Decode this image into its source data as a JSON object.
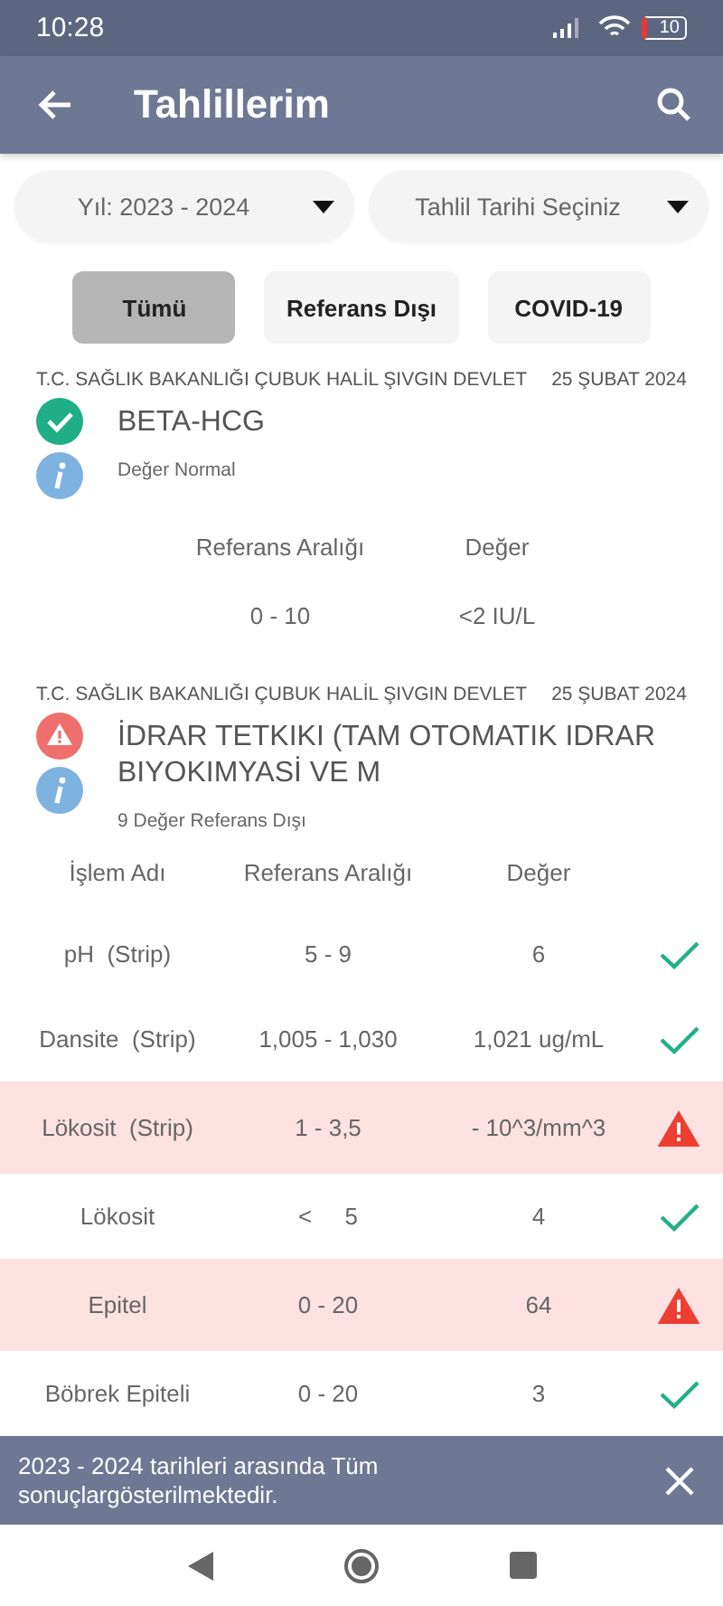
{
  "status_bar": {
    "time": "10:28",
    "battery": "10"
  },
  "app_bar": {
    "title": "Tahlillerim"
  },
  "filters": [
    {
      "value": "Yıl: 2023 - 2024"
    },
    {
      "value": "Tahlil Tarihi Seçiniz"
    }
  ],
  "chips": [
    {
      "label": "Tümü",
      "selected": true
    },
    {
      "label": "Referans Dışı",
      "selected": false
    },
    {
      "label": "COVID-19",
      "selected": false
    }
  ],
  "results": [
    {
      "hospital": "T.C. SAĞLIK BAKANLIĞI ÇUBUK HALİL ŞIVGIN DEVLET",
      "date": "25 ŞUBAT 2024",
      "name": "BETA-HCG",
      "out_of_range": false,
      "summary": "Değer Normal",
      "columns": [
        "Referans Aralığı",
        "Değer"
      ],
      "rows": [
        {
          "cells": [
            "0 - 10",
            "<2 IU/L"
          ]
        }
      ]
    },
    {
      "hospital": "T.C. SAĞLIK BAKANLIĞI ÇUBUK HALİL ŞIVGIN DEVLET",
      "date": "25 ŞUBAT 2024",
      "name": "İDRAR TETKIKI (TAM OTOMATIK IDRAR BIYOKIMYASİ VE M",
      "out_of_range": true,
      "summary": "9 Değer Referans Dışı",
      "columns": [
        "İşlem Adı",
        "Referans Aralığı",
        "Değer"
      ],
      "rows": [
        {
          "cells": [
            "pH  (Strip)",
            "5 - 9",
            "6"
          ],
          "out_of_range": false
        },
        {
          "cells": [
            "Dansite  (Strip)",
            "1,005 - 1,030",
            "1,021 ug/mL"
          ],
          "out_of_range": false
        },
        {
          "cells": [
            "Lökosit  (Strip)",
            "1 - 3,5",
            "- 10^3/mm^3"
          ],
          "out_of_range": true
        },
        {
          "cells": [
            "Lökosit",
            "<     5",
            "4"
          ],
          "out_of_range": false
        },
        {
          "cells": [
            "Epitel",
            "0 - 20",
            "64"
          ],
          "out_of_range": true
        },
        {
          "cells": [
            "Böbrek Epiteli",
            "0 - 20",
            "3"
          ],
          "out_of_range": false
        }
      ]
    }
  ],
  "snackbar": {
    "message": "2023 - 2024 tarihleri arasında Tüm sonuçlargösterilmektedir."
  }
}
